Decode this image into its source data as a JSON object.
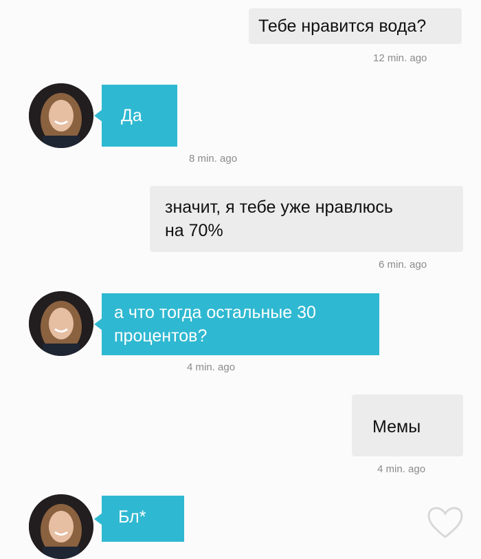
{
  "messages": [
    {
      "side": "sent",
      "text": "Тебе нравится вода?",
      "time": "12 min. ago"
    },
    {
      "side": "received",
      "text": "Да",
      "time": "8 min. ago"
    },
    {
      "side": "sent",
      "text_line1": "значит, я тебе уже нравлюсь",
      "text_line2": "на 70%",
      "time": "6 min. ago"
    },
    {
      "side": "received",
      "text_line1": "а что тогда остальные 30",
      "text_line2": "процентов?",
      "time": "4 min. ago"
    },
    {
      "side": "sent",
      "text": "Мемы",
      "time": "4 min. ago"
    },
    {
      "side": "received",
      "text": "Бл*"
    }
  ],
  "icons": {
    "avatar": "contact-photo",
    "like": "heart-outline-icon"
  },
  "colors": {
    "received_bubble": "#2fb8d1",
    "sent_bubble": "#ececec",
    "timestamp": "#8a8a8a"
  }
}
